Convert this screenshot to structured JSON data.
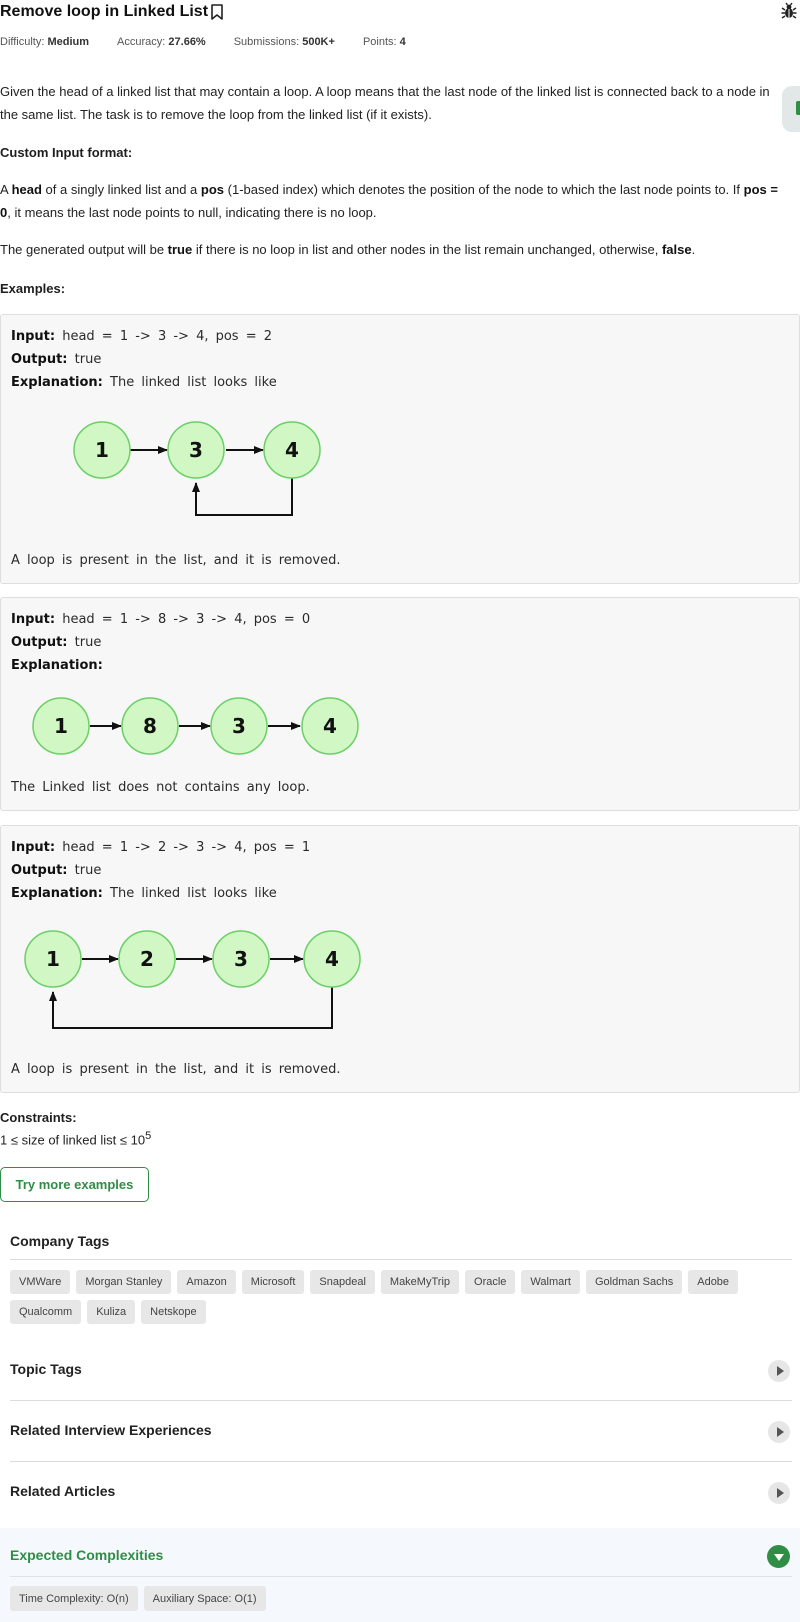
{
  "problem": {
    "title": "Remove loop in Linked List",
    "difficulty_label": "Difficulty:",
    "difficulty": "Medium",
    "accuracy_label": "Accuracy:",
    "accuracy": "27.66%",
    "submissions_label": "Submissions:",
    "submissions": "500K+",
    "points_label": "Points:",
    "points": "4"
  },
  "description": {
    "intro": "Given the head of a linked list that may contain a loop.  A loop means that the last node of the linked list is connected back to a node in the same list. The task is to remove the loop from the linked list (if it exists).",
    "custom_input_heading": "Custom Input format:",
    "custom_input_1a": "A ",
    "custom_input_head": "head",
    "custom_input_1b": " of a singly linked list and a ",
    "custom_input_pos": "pos",
    "custom_input_1c": " (1-based index) which denotes the position of the node to which the last node points to. If ",
    "custom_input_pos0": "pos = 0",
    "custom_input_1d": ", it means the last node points to null, indicating there is no loop.",
    "output_a": "The generated output will be ",
    "output_true": "true",
    "output_b": " if there is no loop in list and other nodes in the list remain unchanged, otherwise, ",
    "output_false": "false",
    "output_c": ".",
    "examples_heading": "Examples:"
  },
  "labels": {
    "input": "Input:",
    "output": "Output:",
    "explanation": "Explanation:"
  },
  "examples": [
    {
      "input": "head = 1 -> 3 -> 4, pos = 2",
      "output": "true",
      "explanation": "The linked list looks like",
      "nodes": [
        "1",
        "3",
        "4"
      ],
      "loop_to": 2,
      "note": "A loop is present in the list, and it is removed."
    },
    {
      "input": "head = 1 -> 8 -> 3 -> 4, pos = 0",
      "output": "true",
      "explanation": "",
      "nodes": [
        "1",
        "8",
        "3",
        "4"
      ],
      "loop_to": 0,
      "note": "The Linked list does not contains any loop."
    },
    {
      "input": "head = 1 -> 2 -> 3 -> 4, pos = 1",
      "output": "true",
      "explanation": "The linked list looks like",
      "nodes": [
        "1",
        "2",
        "3",
        "4"
      ],
      "loop_to": 1,
      "note": "A loop is present in the list, and it is removed."
    }
  ],
  "constraints": {
    "heading": "Constraints:",
    "text": "1 ≤ size of linked list ≤ 10",
    "exponent": "5"
  },
  "try_button": "Try more examples",
  "company_tags": {
    "heading": "Company Tags",
    "tags": [
      "VMWare",
      "Morgan Stanley",
      "Amazon",
      "Microsoft",
      "Snapdeal",
      "MakeMyTrip",
      "Oracle",
      "Walmart",
      "Goldman Sachs",
      "Adobe",
      "Qualcomm",
      "Kuliza",
      "Netskope"
    ]
  },
  "accordions": [
    {
      "title": "Topic Tags"
    },
    {
      "title": "Related Interview Experiences"
    },
    {
      "title": "Related Articles"
    }
  ],
  "complexities": {
    "heading": "Expected Complexities",
    "time": "Time Complexity: O(n)",
    "space": "Auxiliary Space: O(1)"
  },
  "colors": {
    "accent": "#2f8d46",
    "node_fill": "#d1f7c4",
    "node_stroke": "#6ccf68"
  },
  "icons": [
    "bookmark-icon",
    "bug-icon",
    "chevron-right-icon",
    "chevron-down-icon"
  ]
}
